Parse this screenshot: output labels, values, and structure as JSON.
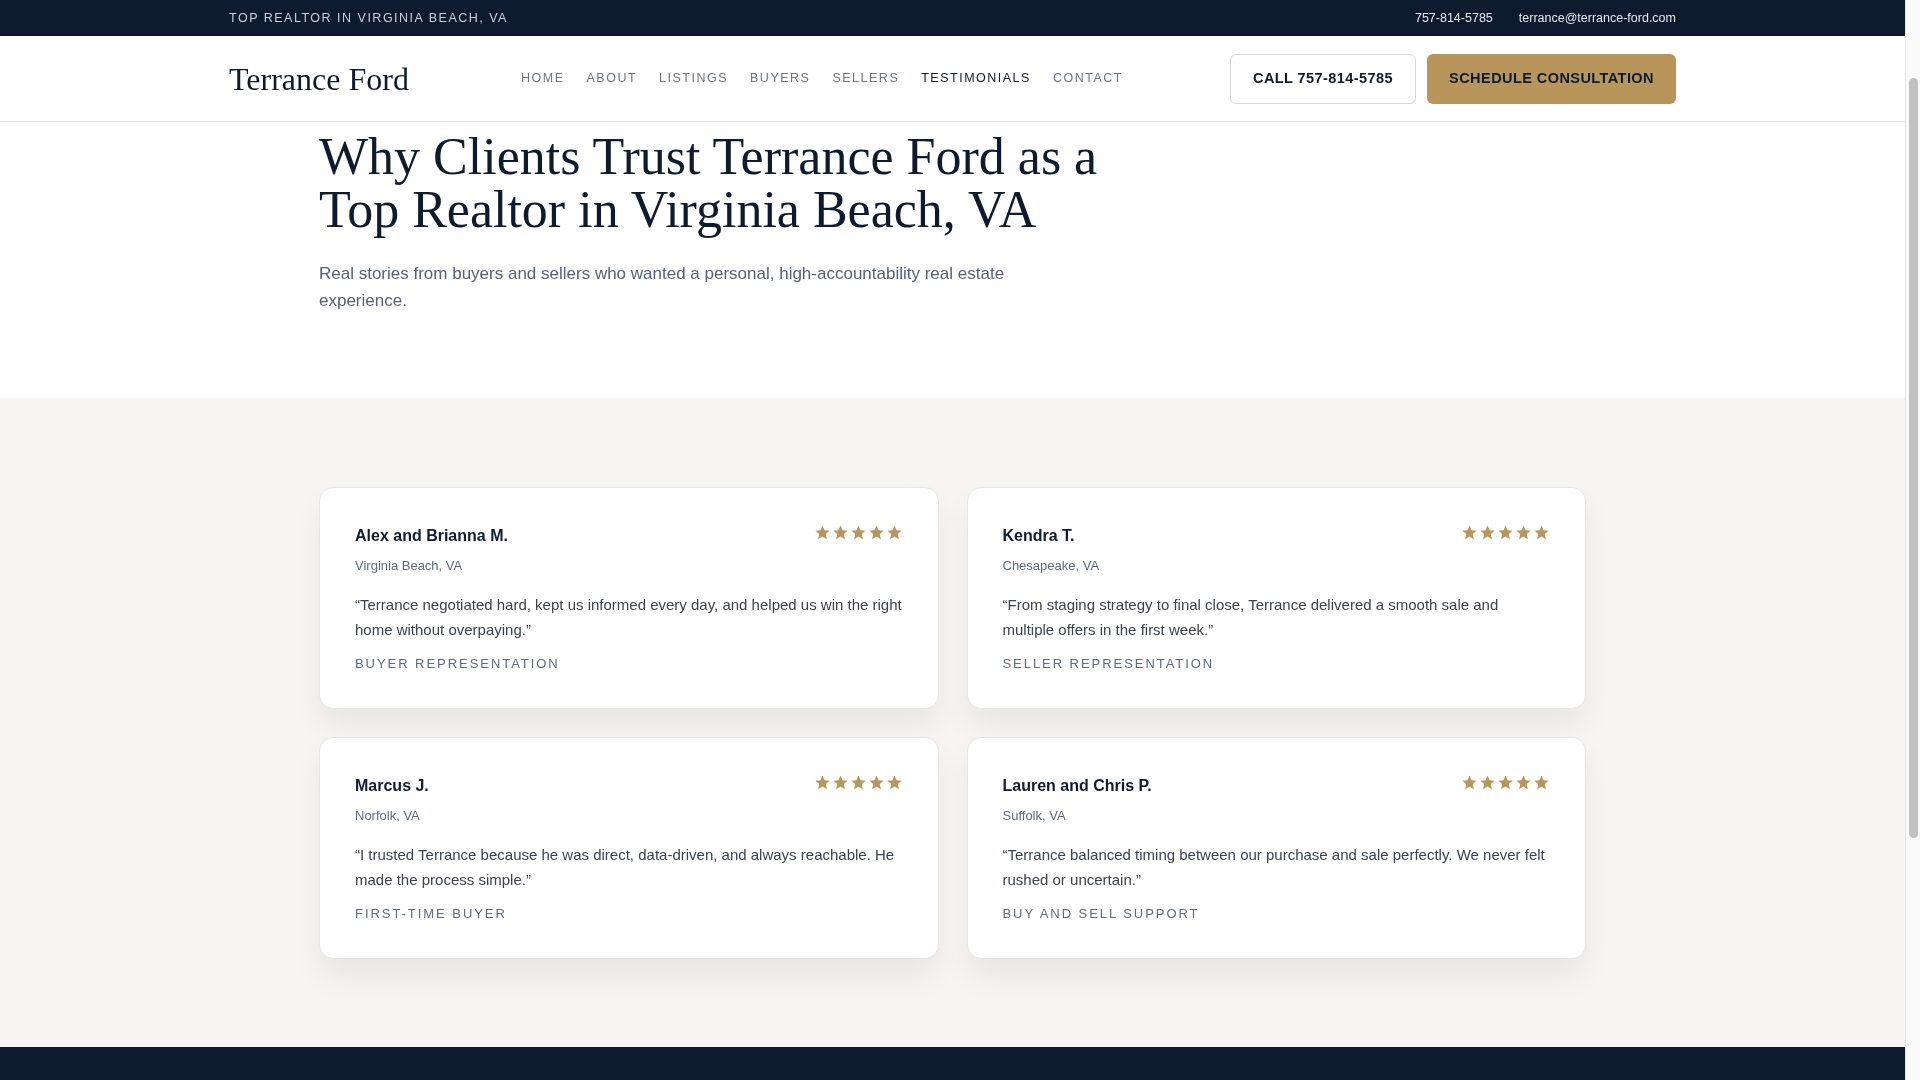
{
  "top_bar": {
    "tagline": "TOP REALTOR IN VIRGINIA BEACH, VA",
    "phone": "757-814-5785",
    "email": "terrance@terrance-ford.com"
  },
  "header": {
    "logo": "Terrance Ford",
    "nav": [
      {
        "label": "HOME",
        "selected": false
      },
      {
        "label": "ABOUT",
        "selected": false
      },
      {
        "label": "LISTINGS",
        "selected": false
      },
      {
        "label": "BUYERS",
        "selected": false
      },
      {
        "label": "SELLERS",
        "selected": false
      },
      {
        "label": "TESTIMONIALS",
        "selected": true
      },
      {
        "label": "CONTACT",
        "selected": false
      }
    ],
    "call_button": "CALL 757-814-5785",
    "schedule_button": "SCHEDULE CONSULTATION"
  },
  "hero": {
    "title": "Why Clients Trust Terrance Ford as a Top Realtor in Virginia Beach, VA",
    "subtitle": "Real stories from buyers and sellers who wanted a personal, high-accountability real estate experience."
  },
  "testimonials": [
    {
      "name": "Alex and Brianna M.",
      "location": "Virginia Beach, VA",
      "stars": 5,
      "quote": "“Terrance negotiated hard, kept us informed every day, and helped us win the right home without overpaying.”",
      "category": "BUYER REPRESENTATION"
    },
    {
      "name": "Kendra T.",
      "location": "Chesapeake, VA",
      "stars": 5,
      "quote": "“From staging strategy to final close, Terrance delivered a smooth sale and multiple offers in the first week.”",
      "category": "SELLER REPRESENTATION"
    },
    {
      "name": "Marcus J.",
      "location": "Norfolk, VA",
      "stars": 5,
      "quote": "“I trusted Terrance because he was direct, data-driven, and always reachable. He made the process simple.”",
      "category": "FIRST-TIME BUYER"
    },
    {
      "name": "Lauren and Chris P.",
      "location": "Suffolk, VA",
      "stars": 5,
      "quote": "“Terrance balanced timing between our purchase and sale perfectly. We never felt rushed or uncertain.”",
      "category": "BUY AND SELL SUPPORT"
    }
  ]
}
